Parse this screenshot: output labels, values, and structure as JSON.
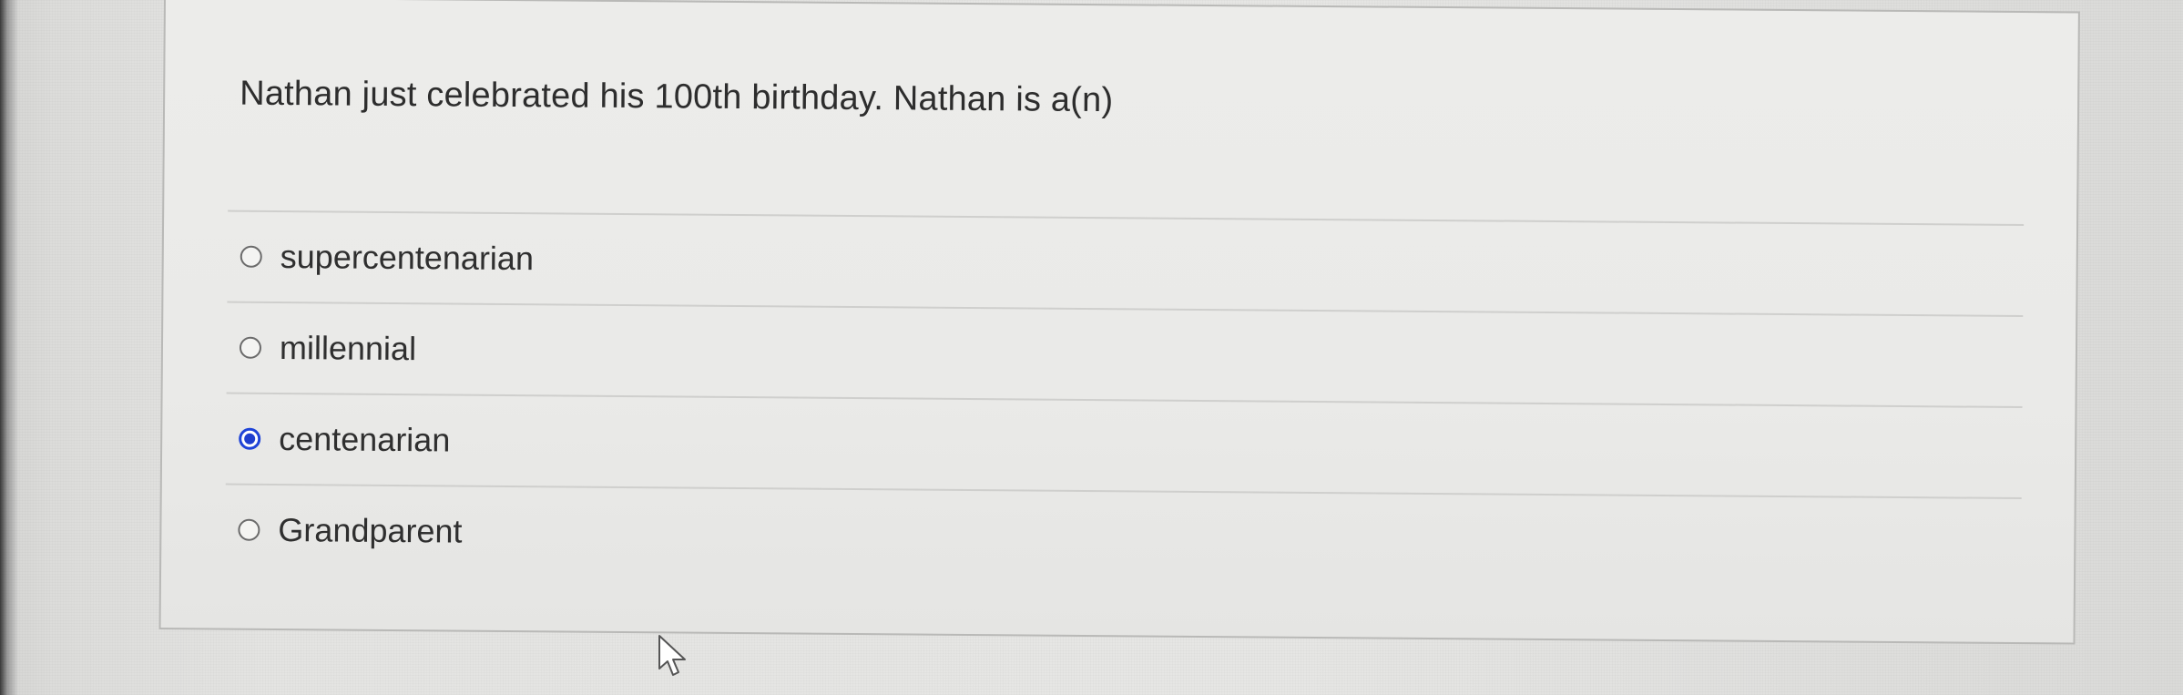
{
  "question": {
    "text": "Nathan just celebrated his 100th birthday. Nathan is a(n)"
  },
  "answers": [
    {
      "label": "supercentenarian",
      "selected": false
    },
    {
      "label": "millennial",
      "selected": false
    },
    {
      "label": "centenarian",
      "selected": true
    },
    {
      "label": "Grandparent",
      "selected": false
    }
  ],
  "colors": {
    "selected_radio": "#1f44d8",
    "card_background": "#ececea"
  },
  "icons": {
    "cursor": "mouse-pointer-icon"
  }
}
